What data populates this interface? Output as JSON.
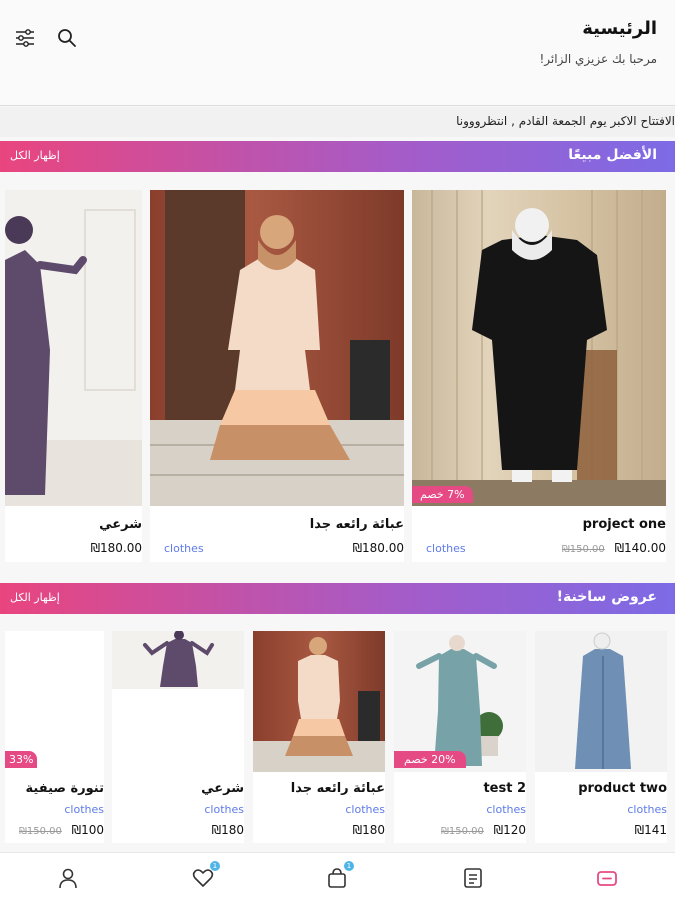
{
  "header": {
    "title": "الرئيسية",
    "subtitle": "مرحبا بك عزيزي الزائر!"
  },
  "marquee": {
    "text": "الافتتاح الاكبر يوم الجمعة القادم , انتظرووونا"
  },
  "best_sellers": {
    "title": "الأفضل مبيعًا",
    "show_all": "إظهار الكل",
    "products": [
      {
        "name": "project one",
        "category": "clothes",
        "price": "₪140.00",
        "old_price": "₪150.00",
        "badge": "7% خصم"
      },
      {
        "name": "عبائة رائعه جدا",
        "category": "clothes",
        "price": "₪180.00",
        "old_price": "",
        "badge": ""
      },
      {
        "name": "شرعي",
        "category": "",
        "price": "₪180.00",
        "old_price": "",
        "badge": ""
      }
    ]
  },
  "hot_offers": {
    "title": "عروض ساخنة!",
    "show_all": "إظهار الكل",
    "products": [
      {
        "name": "product two",
        "category": "clothes",
        "price": "₪141",
        "old_price": "",
        "badge": ""
      },
      {
        "name": "test 2",
        "category": "clothes",
        "price": "₪120",
        "old_price": "₪150.00",
        "badge": "20% خصم"
      },
      {
        "name": "عبائة رائعه جدا",
        "category": "clothes",
        "price": "₪180",
        "old_price": "",
        "badge": ""
      },
      {
        "name": "شرعي",
        "category": "clothes",
        "price": "₪180",
        "old_price": "",
        "badge": ""
      },
      {
        "name": "تنورة صيفية",
        "category": "clothes",
        "price": "₪100",
        "old_price": "₪150.00",
        "badge": "33%"
      }
    ]
  },
  "bottom_nav": {
    "favorites_count": "1",
    "cart_count": "1"
  },
  "colors": {
    "accent_pink": "#e64a84",
    "accent_purple": "#7d6be6",
    "category_blue": "#5e7be8"
  }
}
